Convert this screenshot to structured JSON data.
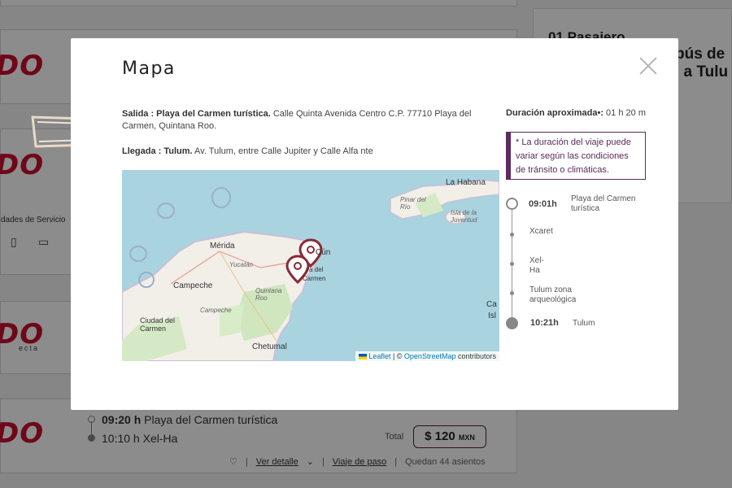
{
  "background": {
    "passengers": "01 Pasajero",
    "route_title_line1": "bús de",
    "route_title_line2": ". a Tulu",
    "amenities_label": "dades de Servicio",
    "logo_text_1": "DO",
    "logo_text_2": "DO",
    "logo_text_3": "DO",
    "logo_sub": "ecta",
    "logo_text_4": "DO",
    "trip": {
      "dep_time": "09:20 h",
      "dep_place": "Playa del Carmen turística",
      "arr": "10:10 h Xel-Ha"
    },
    "total_label": "Total",
    "price": "$ 120",
    "currency": "MXN",
    "links": {
      "detail": "Ver detalle",
      "stops": "Viaje de paso",
      "seats": "Quedan 44 asientos"
    }
  },
  "modal": {
    "title": "Mapa",
    "departure_label": "Salida : Playa del Carmen turística.",
    "departure_address": " Calle Quinta Avenida Centro C.P. 77710 Playa del Carmen, Quintana Roo.",
    "arrival_label": "Llegada : Tulum.",
    "arrival_address": " Av. Tulum, entre Calle Jupiter y Calle Alfa nte",
    "duration_label": "Duración aproximada•:",
    "duration_value": " 01 h 20 m",
    "note": "* La duración del viaje puede variar según las condiciones de tránsito o climáticas.",
    "map": {
      "labels": {
        "habana": "La Habana",
        "merida": "Mérida",
        "campeche": "Campeche",
        "ciudad_carmen": "Ciudad del Carmen",
        "chetumal": "Chetumal",
        "cancun": "Cún",
        "playa": "ya del",
        "carmen": "Carmen",
        "pinar": "Pinar del Río",
        "isla": "Isla de la Juventud",
        "yucatan": "Yucatán",
        "quintana": "Quintana Roo",
        "campeche_state": "Campeche",
        "ca": "Ca",
        "isl": "Isl"
      },
      "attribution_leaflet": "Leaflet",
      "attribution_sep": " | © ",
      "attribution_osm": "OpenStreetMap",
      "attribution_tail": " contributors"
    },
    "stops": [
      {
        "time": "09:01h",
        "place": "Playa del Carmen turística"
      },
      {
        "time": "",
        "place": "Xcaret"
      },
      {
        "time": "",
        "place": "Xel-Ha"
      },
      {
        "time": "",
        "place": "Tulum zona arqueológica"
      },
      {
        "time": "10:21h",
        "place": "Tulum"
      }
    ]
  }
}
